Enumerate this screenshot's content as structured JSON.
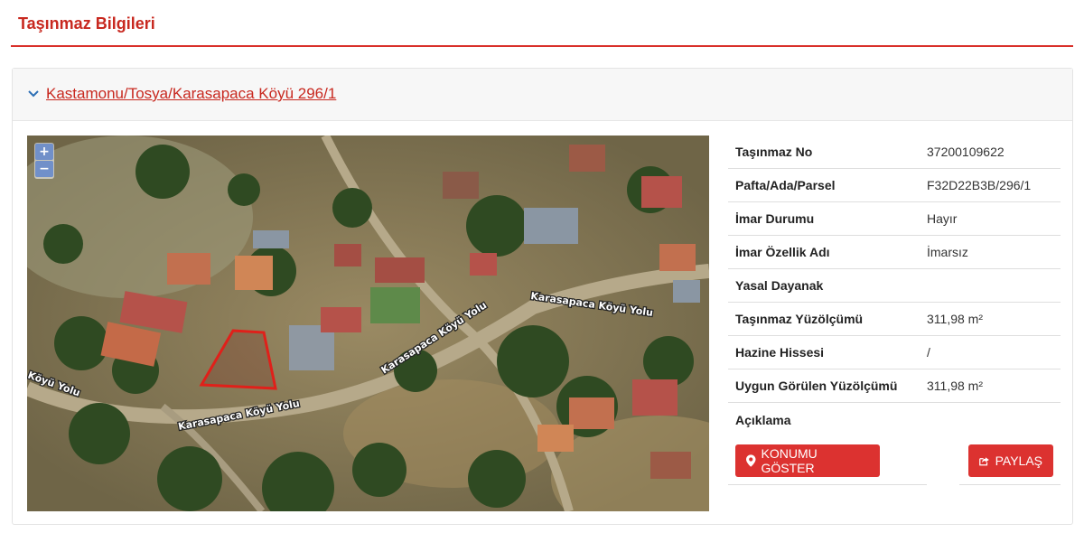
{
  "header": {
    "title": "Taşınmaz Bilgileri"
  },
  "panel": {
    "title": "Kastamonu/Tosya/Karasapaca Köyü 296/1"
  },
  "map": {
    "zoom_in": "+",
    "zoom_out": "−",
    "road_labels": [
      "Karasapaca Köyü Yolu",
      "Karasapaca Köyü Yolu",
      "Karasapaca Köyü Yolu",
      "Köyü Yolu"
    ]
  },
  "details": [
    {
      "label": "Taşınmaz No",
      "value": "37200109622"
    },
    {
      "label": "Pafta/Ada/Parsel",
      "value": "F32D22B3B/296/1"
    },
    {
      "label": "İmar Durumu",
      "value": "Hayır"
    },
    {
      "label": "İmar Özellik Adı",
      "value": "İmarsız"
    },
    {
      "label": "Yasal Dayanak",
      "value": ""
    },
    {
      "label": "Taşınmaz Yüzölçümü",
      "value": "311,98 m²"
    },
    {
      "label": "Hazine Hissesi",
      "value": "/"
    },
    {
      "label": "Uygun Görülen Yüzölçümü",
      "value": "311,98 m²"
    },
    {
      "label": "Açıklama",
      "value": ""
    }
  ],
  "buttons": {
    "show_location": "KONUMU GÖSTER",
    "share": "PAYLAŞ"
  },
  "colors": {
    "accent": "#dc3230",
    "title": "#c8281f"
  }
}
